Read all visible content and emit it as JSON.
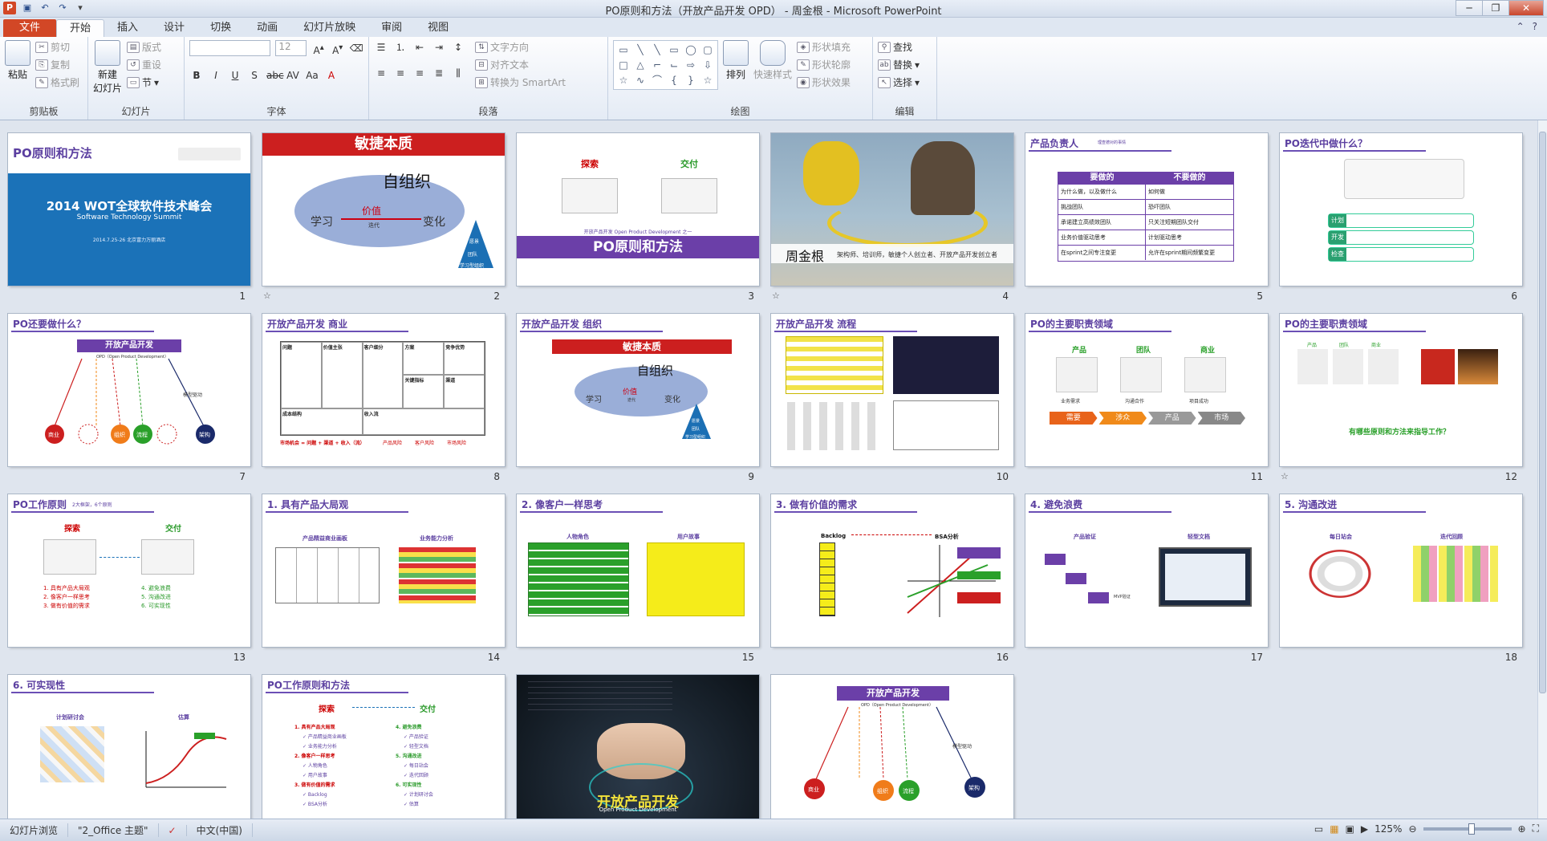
{
  "window": {
    "title": "PO原则和方法（开放产品开发 OPD） - 周金根 - Microsoft PowerPoint",
    "qat_icons": [
      "powerpoint-icon",
      "save-icon",
      "undo-icon",
      "redo-icon",
      "customize-icon"
    ]
  },
  "tabs": [
    "文件",
    "开始",
    "插入",
    "设计",
    "切换",
    "动画",
    "幻灯片放映",
    "审阅",
    "视图"
  ],
  "active_tab": "开始",
  "ribbon": {
    "clipboard": {
      "paste": "粘贴",
      "cut": "剪切",
      "copy": "复制",
      "painter": "格式刷",
      "label": "剪贴板"
    },
    "slides": {
      "new_slide": "新建\n幻灯片",
      "layout": "版式",
      "reset": "重设",
      "section": "节",
      "label": "幻灯片"
    },
    "font": {
      "font_name": "",
      "font_size": "12",
      "label": "字体",
      "buttons": [
        "B",
        "I",
        "U",
        "S",
        "abc",
        "AV",
        "Aa",
        "A"
      ]
    },
    "paragraph": {
      "text_direction": "文字方向",
      "align_text": "对齐文本",
      "smartart": "转换为 SmartArt",
      "label": "段落"
    },
    "drawing": {
      "arrange": "排列",
      "quick_styles": "快速样式",
      "shape_fill": "形状填充",
      "shape_outline": "形状轮廓",
      "shape_effects": "形状效果",
      "label": "绘图"
    },
    "editing": {
      "find": "查找",
      "replace": "替换",
      "select": "选择",
      "label": "编辑"
    }
  },
  "slides": [
    {
      "n": "1",
      "title": "PO原则和方法",
      "headline": "2014 WOT全球软件技术峰会",
      "sub": "Software Technology Summit",
      "date": "2014.7.25-26   北京富力万丽酒店"
    },
    {
      "n": "2",
      "banner": "敏捷本质",
      "center": "自组织",
      "left": "学习",
      "mid": "价值",
      "mid2": "迭代",
      "right": "变化",
      "p1": "愿景",
      "p2": "团队",
      "p3": "学习型组织"
    },
    {
      "n": "3",
      "left": "探索",
      "right": "交付",
      "line": "开放产品开发 Open Product Development 之一",
      "banner": "PO原则和方法"
    },
    {
      "n": "4",
      "name": "周金根",
      "desc": "架构师、培训师，敏捷个人创立者、开放产品开发创立者"
    },
    {
      "n": "5",
      "title": "产品负责人",
      "sub": "理查德对的事情",
      "head_left": "要做的",
      "head_right": "不要做的",
      "rows": [
        [
          "为什么做，以及做什么",
          "如何做"
        ],
        [
          "挑战团队",
          "恐吓团队"
        ],
        [
          "承诺建立高绩效团队",
          "只关注短期团队交付"
        ],
        [
          "业务价值驱动思考",
          "计划驱动思考"
        ],
        [
          "在sprint之间专注变更",
          "允许在sprint期间频繁变更"
        ]
      ]
    },
    {
      "n": "6",
      "title": "PO迭代中做什么？",
      "labels": [
        "计划",
        "开发",
        "检查"
      ]
    },
    {
      "n": "7",
      "title": "PO还要做什么？",
      "banner": "开放产品开发",
      "sub": "OPD（Open Product Development）",
      "circles": [
        "商业",
        "组织",
        "流程",
        "架构"
      ],
      "right": "模型驱动"
    },
    {
      "n": "8",
      "title": "开放产品开发 商业",
      "cells": [
        "问题",
        "方案",
        "价值主张",
        "竞争优势",
        "客户细分",
        "关键指标",
        "渠道",
        "成本结构",
        "收入流"
      ],
      "footer": "市场机会 = 问题 + 渠道 + 收入（流）",
      "foot2": [
        "产品风险",
        "客户风险",
        "市场风险"
      ]
    },
    {
      "n": "9",
      "title": "开放产品开发 组织",
      "banner": "敏捷本质",
      "center": "自组织",
      "left": "学习",
      "mid": "价值",
      "mid2": "迭代",
      "right": "变化",
      "p1": "愿景",
      "p2": "团队",
      "p3": "学习型组织"
    },
    {
      "n": "10",
      "title": "开放产品开发 流程"
    },
    {
      "n": "11",
      "title": "PO的主要职责领域",
      "cols": [
        "产品",
        "团队",
        "商业"
      ],
      "caps": [
        "业务需求",
        "沟通合作",
        "项目成功"
      ],
      "arrows": [
        "需要",
        "涉众",
        "产品",
        "市场"
      ]
    },
    {
      "n": "12",
      "title": "PO的主要职责领域",
      "cols": [
        "产品",
        "团队",
        "商业"
      ],
      "question": "有哪些原则和方法来指导工作？"
    },
    {
      "n": "13",
      "title": "PO工作原则",
      "sub": "2大框架，6个原则",
      "left": "探索",
      "right": "交付",
      "items_left": [
        "1. 具有产品大局观",
        "2. 像客户一样思考",
        "3. 做有价值的需求"
      ],
      "items_right": [
        "4. 避免浪费",
        "5. 沟通改进",
        "6. 可实现性"
      ]
    },
    {
      "n": "14",
      "title": "1. 具有产品大局观",
      "left": "产品精益商业画板",
      "right": "业务能力分析"
    },
    {
      "n": "15",
      "title": "2. 像客户一样思考",
      "left": "人物角色",
      "right": "用户故事"
    },
    {
      "n": "16",
      "title": "3. 做有价值的需求",
      "left": "Backlog",
      "right": "BSA分析"
    },
    {
      "n": "17",
      "title": "4. 避免浪费",
      "left": "产品验证",
      "right": "轻型文档",
      "mvp": "MVP验证"
    },
    {
      "n": "18",
      "title": "5. 沟通改进",
      "left": "每日站会",
      "right": "迭代回顾"
    },
    {
      "n": "19",
      "title": "6. 可实现性",
      "left": "计划研讨会",
      "right": "估算"
    },
    {
      "n": "20",
      "title": "PO工作原则和方法",
      "left": "探索",
      "right": "交付",
      "items_left": [
        "1. 具有产品大局观",
        "✓ 产品精益商业画板",
        "✓ 业务能力分析",
        "2. 像客户一样思考",
        "✓ 人物角色",
        "✓ 用户故事",
        "3. 做有价值的需求",
        "✓ Backlog",
        "✓ BSA分析"
      ],
      "items_right": [
        "4. 避免浪费",
        "✓ 产品验证",
        "✓ 轻型文档",
        "5. 沟通改进",
        "✓ 每日站会",
        "✓ 迭代回顾",
        "6. 可实现性",
        "✓ 计划研讨会",
        "✓ 估算"
      ]
    },
    {
      "n": "21",
      "headline": "开放产品开发",
      "sub": "Open Product Development"
    },
    {
      "n": "22",
      "banner": "开放产品开发",
      "sub": "OPD（Open Product Development）",
      "circles": [
        "商业",
        "组织",
        "流程",
        "架构"
      ],
      "right": "模型驱动"
    }
  ],
  "status": {
    "view": "幻灯片浏览",
    "theme": "\"2_Office 主题\"",
    "lang": "中文(中国)",
    "zoom": "125%"
  },
  "colors": {
    "purple": "#6b4fb5",
    "red": "#cc1f1f",
    "ppt_orange": "#d24726",
    "blue": "#1f6fb4"
  }
}
